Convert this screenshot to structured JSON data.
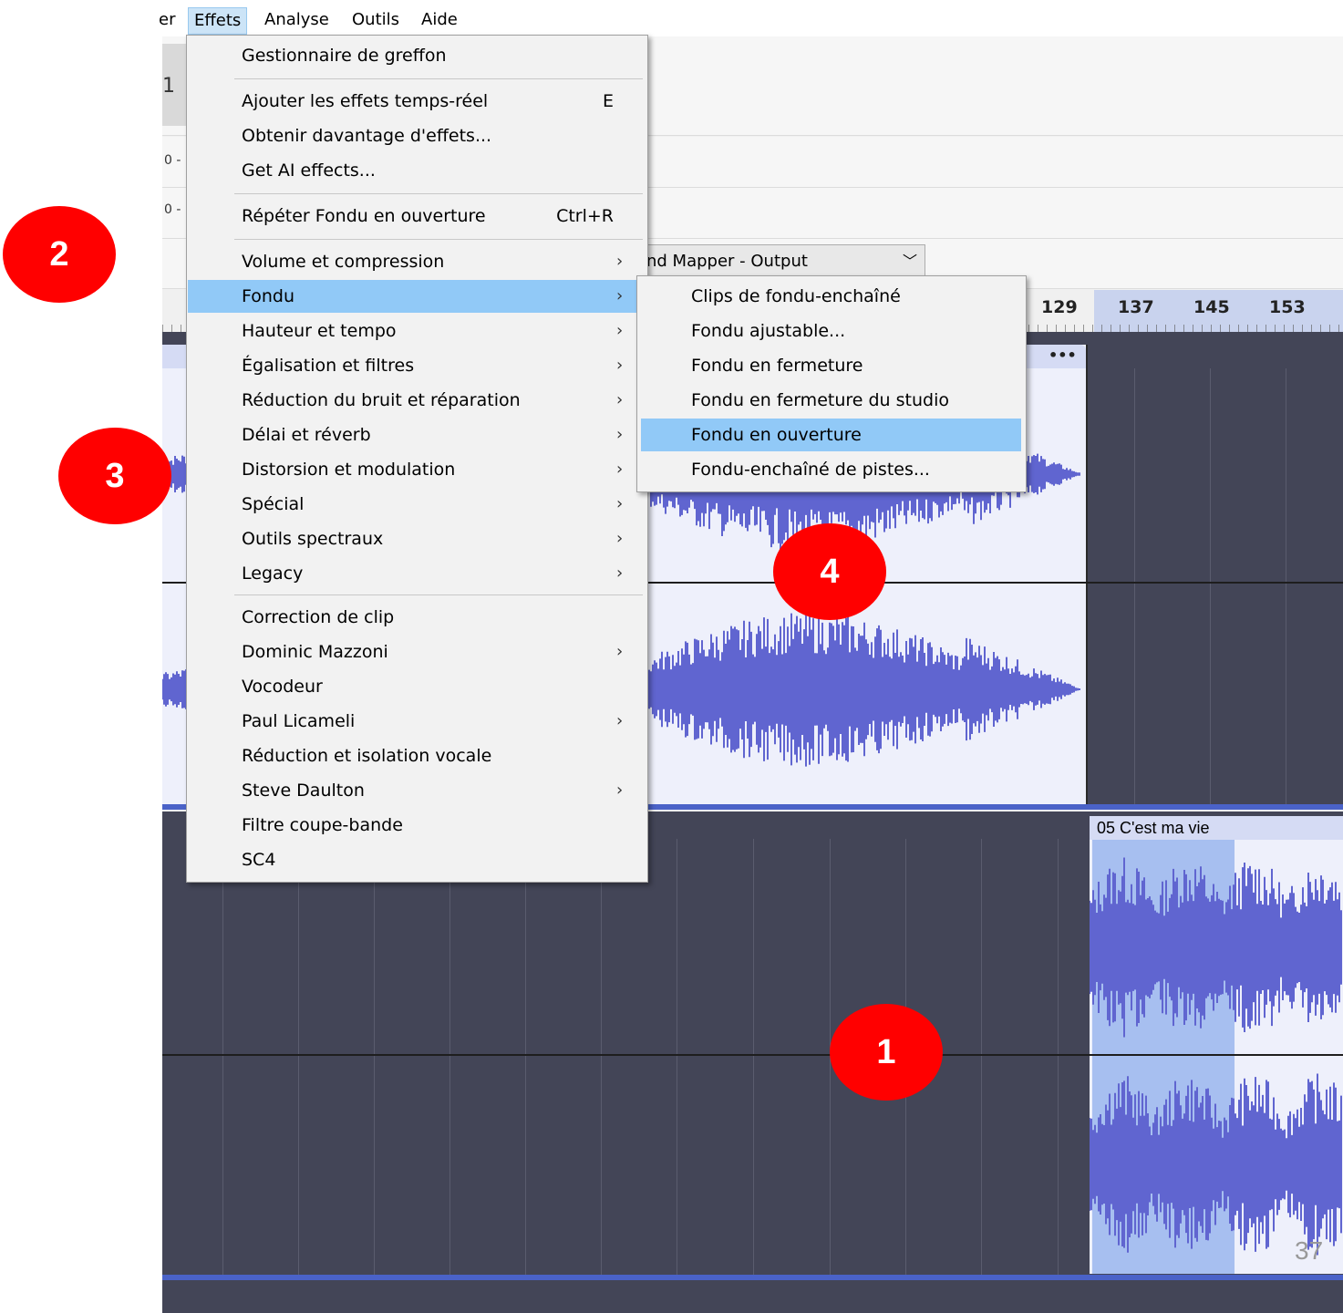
{
  "menubar": {
    "items": [
      "er",
      "Effets",
      "Analyse",
      "Outils",
      "Aide"
    ],
    "active": "Effets"
  },
  "toolbar": {
    "button_glyph": "1",
    "meter_label_1": "0 -",
    "meter_label_2": "0 -",
    "device_select_value": "nd Mapper - Output"
  },
  "ruler": {
    "ticks": [
      "129",
      "137",
      "145",
      "153"
    ]
  },
  "effects_menu": {
    "items": [
      {
        "label": "Gestionnaire de greffon",
        "shortcut": "",
        "submenu": false
      },
      {
        "label": "Ajouter les effets temps-réel",
        "shortcut": "E",
        "submenu": false
      },
      {
        "label": "Obtenir davantage d'effets...",
        "shortcut": "",
        "submenu": false
      },
      {
        "label": "Get AI effects...",
        "shortcut": "",
        "submenu": false
      },
      {
        "label": "Répéter Fondu en ouverture",
        "shortcut": "Ctrl+R",
        "submenu": false
      },
      {
        "label": "Volume et compression",
        "shortcut": "",
        "submenu": true
      },
      {
        "label": "Fondu",
        "shortcut": "",
        "submenu": true
      },
      {
        "label": "Hauteur et tempo",
        "shortcut": "",
        "submenu": true
      },
      {
        "label": "Égalisation et filtres",
        "shortcut": "",
        "submenu": true
      },
      {
        "label": "Réduction du bruit et réparation",
        "shortcut": "",
        "submenu": true
      },
      {
        "label": "Délai et réverb",
        "shortcut": "",
        "submenu": true
      },
      {
        "label": "Distorsion et modulation",
        "shortcut": "",
        "submenu": true
      },
      {
        "label": "Spécial",
        "shortcut": "",
        "submenu": true
      },
      {
        "label": "Outils spectraux",
        "shortcut": "",
        "submenu": true
      },
      {
        "label": "Legacy",
        "shortcut": "",
        "submenu": true
      },
      {
        "label": "Correction de clip",
        "shortcut": "",
        "submenu": false
      },
      {
        "label": "Dominic Mazzoni",
        "shortcut": "",
        "submenu": true
      },
      {
        "label": "Vocodeur",
        "shortcut": "",
        "submenu": false
      },
      {
        "label": "Paul Licameli",
        "shortcut": "",
        "submenu": true
      },
      {
        "label": "Réduction et isolation vocale",
        "shortcut": "",
        "submenu": false
      },
      {
        "label": "Steve Daulton",
        "shortcut": "",
        "submenu": true
      },
      {
        "label": "Filtre coupe-bande",
        "shortcut": "",
        "submenu": false
      },
      {
        "label": "SC4",
        "shortcut": "",
        "submenu": false
      }
    ],
    "highlighted": "Fondu",
    "submenu_arrow": "›"
  },
  "fondu_submenu": {
    "items": [
      "Clips de fondu-enchaîné",
      "Fondu ajustable...",
      "Fondu en fermeture",
      "Fondu en fermeture du studio",
      "Fondu en ouverture",
      "Fondu-enchaîné de pistes..."
    ],
    "highlighted": "Fondu en ouverture"
  },
  "tracks": {
    "track1_clip_menu": "•••",
    "track2_clip_name": "05 C'est ma vie"
  },
  "markers": [
    "1",
    "2",
    "3",
    "4"
  ],
  "page_number": "37",
  "colors": {
    "waveform": "#6065d0",
    "track_bg": "#434557",
    "clip_bg": "#eef0fb",
    "selection": "#a7bff0",
    "menu_highlight": "#91c9f7",
    "marker": "#ff0000"
  }
}
